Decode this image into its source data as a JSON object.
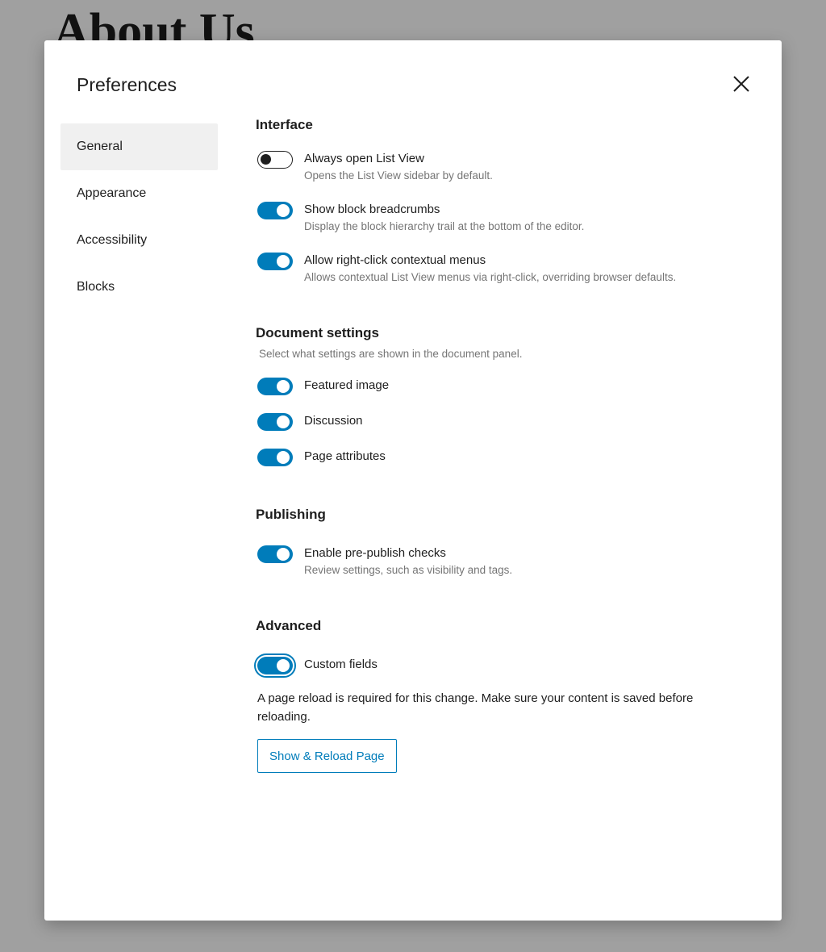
{
  "background": {
    "page_title": "About Us"
  },
  "modal": {
    "title": "Preferences",
    "close_icon": "close-icon"
  },
  "sidebar": {
    "items": [
      {
        "label": "General",
        "active": true
      },
      {
        "label": "Appearance",
        "active": false
      },
      {
        "label": "Accessibility",
        "active": false
      },
      {
        "label": "Blocks",
        "active": false
      }
    ]
  },
  "interface": {
    "title": "Interface",
    "items": [
      {
        "label": "Always open List View",
        "help": "Opens the List View sidebar by default.",
        "checked": false
      },
      {
        "label": "Show block breadcrumbs",
        "help": "Display the block hierarchy trail at the bottom of the editor.",
        "checked": true
      },
      {
        "label": "Allow right-click contextual menus",
        "help": "Allows contextual List View menus via right-click, overriding browser defaults.",
        "checked": true
      }
    ]
  },
  "document_settings": {
    "title": "Document settings",
    "description": "Select what settings are shown in the document panel.",
    "items": [
      {
        "label": "Featured image",
        "checked": true
      },
      {
        "label": "Discussion",
        "checked": true
      },
      {
        "label": "Page attributes",
        "checked": true
      }
    ]
  },
  "publishing": {
    "title": "Publishing",
    "items": [
      {
        "label": "Enable pre-publish checks",
        "help": "Review settings, such as visibility and tags.",
        "checked": true
      }
    ]
  },
  "advanced": {
    "title": "Advanced",
    "items": [
      {
        "label": "Custom fields",
        "checked": true,
        "focused": true
      }
    ],
    "notice": "A page reload is required for this change. Make sure your content is saved before reloading.",
    "reload_button": "Show & Reload Page"
  },
  "colors": {
    "accent": "#007cba",
    "text": "#1e1e1e",
    "muted": "#757575",
    "overlay": "#a0a0a0"
  }
}
